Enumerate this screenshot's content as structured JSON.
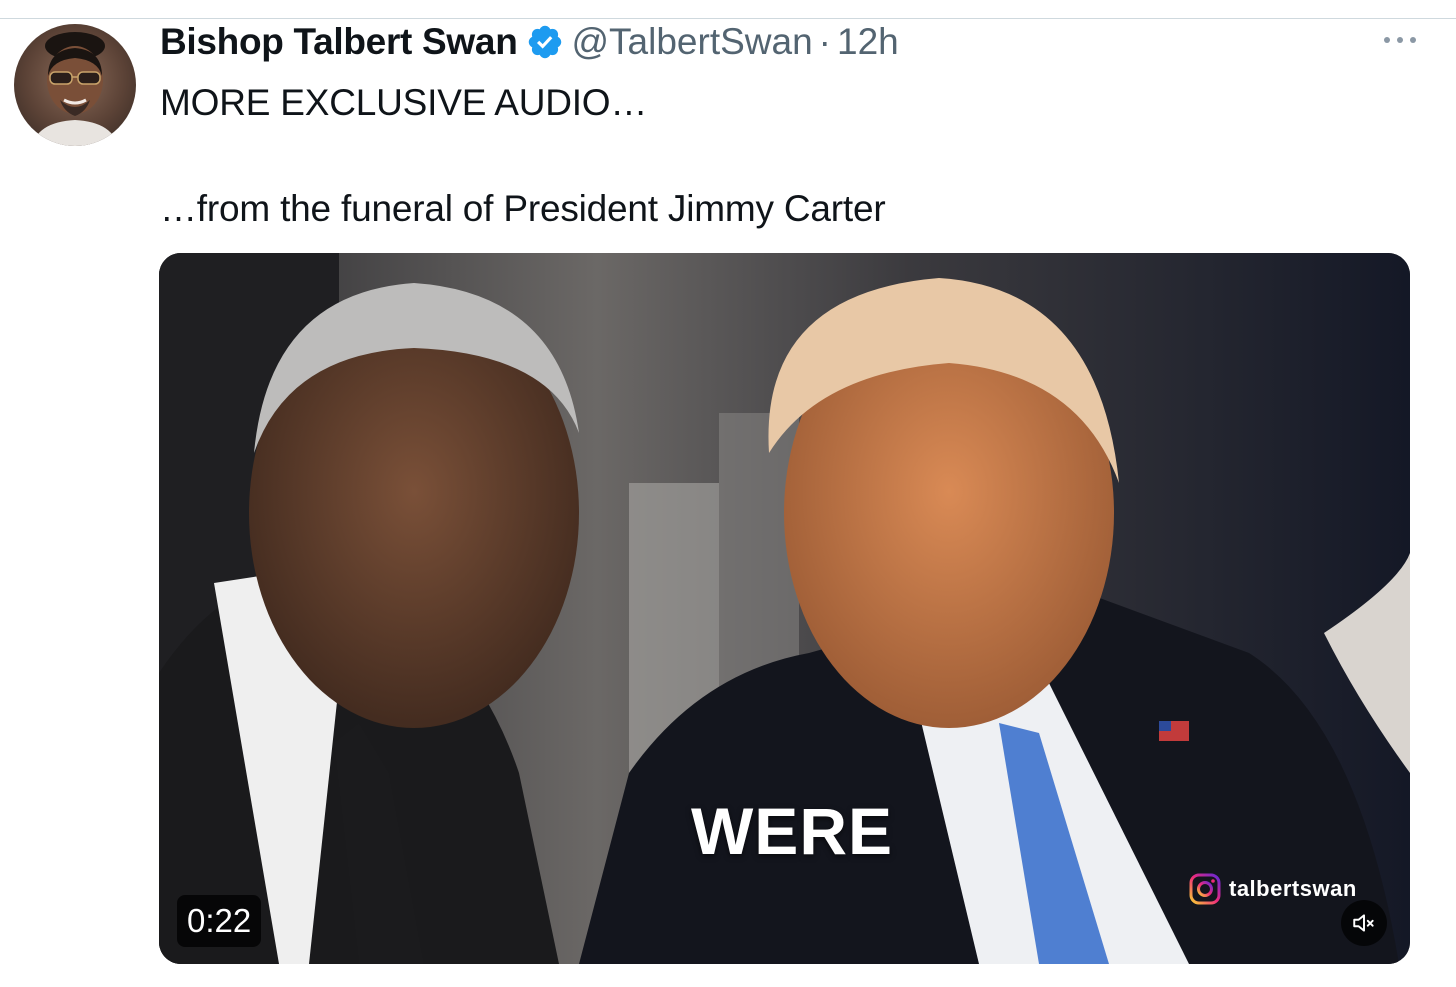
{
  "post": {
    "author": {
      "display_name": "Bishop Talbert Swan",
      "handle": "@TalbertSwan",
      "verified": true,
      "verified_icon": "verified-badge-icon",
      "verified_color": "#1d9bf0"
    },
    "separator": "·",
    "time": "12h",
    "more_icon": "more-options-icon",
    "text_line_1": "MORE EXCLUSIVE AUDIO…",
    "text_line_2": "…from the funeral of President Jimmy Carter"
  },
  "video": {
    "caption": "WERE",
    "duration": "0:22",
    "watermark": {
      "icon": "instagram-icon",
      "handle": "talbertswan"
    },
    "mute_icon": "muted-speaker-icon"
  },
  "colors": {
    "text": "#0f1419",
    "secondary": "#536471",
    "accent": "#1d9bf0",
    "divider": "#cfd9de"
  }
}
